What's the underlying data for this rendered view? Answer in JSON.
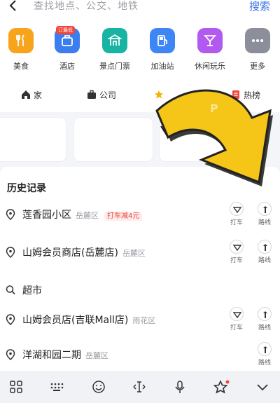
{
  "search": {
    "placeholder": "查找地点、公交、地铁",
    "button_label": "搜索"
  },
  "categories": [
    {
      "label": "美食",
      "color": "#f7a31c",
      "icon": "fork-knife-icon"
    },
    {
      "label": "酒店",
      "color": "#3c7ef0",
      "icon": "hotel-icon",
      "badge": "订最低"
    },
    {
      "label": "景点门票",
      "color": "#17b3a3",
      "icon": "scenic-gate-icon"
    },
    {
      "label": "加油站",
      "color": "#3e86f5",
      "icon": "gas-pump-icon"
    },
    {
      "label": "休闲玩乐",
      "color": "#b25af0",
      "icon": "cocktail-icon"
    },
    {
      "label": "更多",
      "color": "#8c8f99",
      "icon": "more-dots-icon"
    }
  ],
  "shortcuts": [
    {
      "label": "家",
      "icon": "home-icon"
    },
    {
      "label": "公司",
      "icon": "briefcase-icon"
    },
    {
      "label": "",
      "icon": "star-icon"
    },
    {
      "label": "热榜",
      "icon": "hot-list-icon"
    }
  ],
  "history": {
    "title": "历史记录",
    "items": [
      {
        "name": "莲香园小区",
        "area": "岳麓区",
        "tag": "打车减4元",
        "taxi": "打车",
        "route": "路线"
      },
      {
        "name": "山姆会员商店(岳麓店)",
        "area": "岳麓区",
        "tag": "",
        "taxi": "打车",
        "route": "路线"
      },
      {
        "name": "超市",
        "area": "",
        "tag": "",
        "taxi": "",
        "route": ""
      },
      {
        "name": "山姆会员店(吉联Mall店)",
        "area": "雨花区",
        "tag": "",
        "taxi": "打车",
        "route": "路线"
      },
      {
        "name": "洋湖和园二期",
        "area": "岳麓区",
        "tag": "",
        "taxi": "",
        "route": "路线"
      }
    ]
  },
  "colors": {
    "accent": "#2f6ae6",
    "arrow": "#f5c518",
    "promo": "#f0473e"
  },
  "keyboard_icons": [
    "grid-icon",
    "keypad-icon",
    "emoji-icon",
    "cursor-icon",
    "microphone-icon",
    "star-skin-icon",
    "collapse-icon"
  ]
}
